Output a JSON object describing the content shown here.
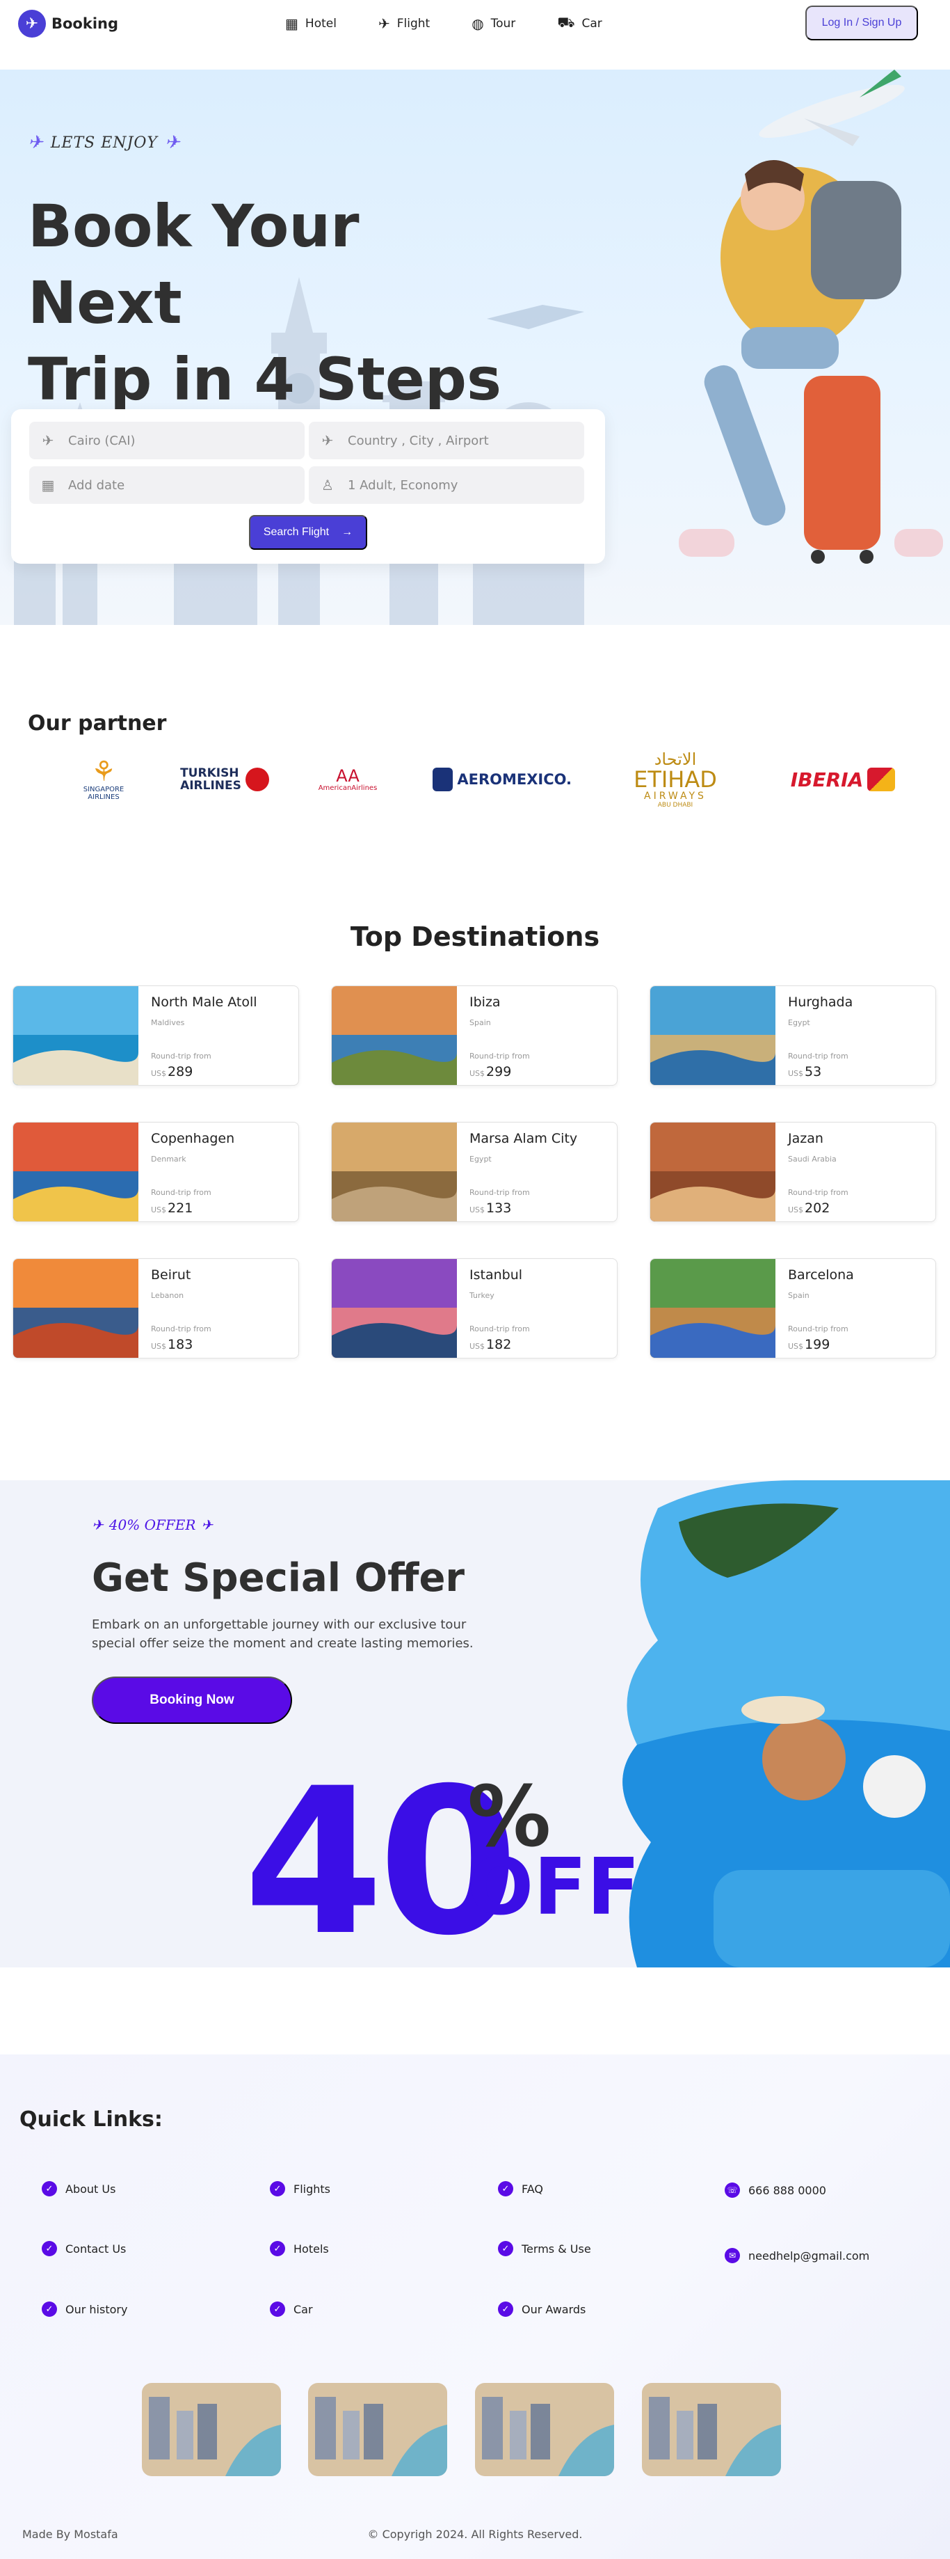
{
  "nav": {
    "brand": "Booking",
    "links": [
      {
        "label": "Hotel",
        "icon": "building-icon"
      },
      {
        "label": "Flight",
        "icon": "plane-icon"
      },
      {
        "label": "Tour",
        "icon": "globe-icon"
      },
      {
        "label": "Car",
        "icon": "car-icon"
      }
    ],
    "login_label": "Log In / Sign Up"
  },
  "hero": {
    "tag": "LETS ENJOY",
    "title_line1": "Book Your Next",
    "title_line2": "Trip in 4 Steps",
    "search": {
      "from": "Cairo (CAI)",
      "to": "Country , City , Airport",
      "date": "Add date",
      "travelers": "1 Adult, Economy",
      "button": "Search Flight"
    }
  },
  "partners": {
    "title": "Our partner",
    "logos": [
      {
        "name": "Singapore Airlines",
        "line1": "SINGAPORE",
        "line2": "AIRLINES"
      },
      {
        "name": "Turkish Airlines",
        "line1": "TURKISH",
        "line2": "AIRLINES"
      },
      {
        "name": "American Airlines",
        "line1": "AmericanAirlines"
      },
      {
        "name": "Aeromexico",
        "line1": "AEROMEXICO."
      },
      {
        "name": "Etihad Airways",
        "line1": "الاتحاد",
        "line2": "ETIHAD",
        "line3": "AIRWAYS",
        "line4": "ABU DHABI"
      },
      {
        "name": "Iberia",
        "line1": "IBERIA"
      }
    ]
  },
  "destinations": {
    "title": "Top Destinations",
    "from_label": "Round-trip from",
    "currency": "US$",
    "items": [
      {
        "name": "North Male Atoll",
        "country": "Maldives",
        "price": "289"
      },
      {
        "name": "Ibiza",
        "country": "Spain",
        "price": "299"
      },
      {
        "name": "Hurghada",
        "country": "Egypt",
        "price": "53"
      },
      {
        "name": "Copenhagen",
        "country": "Denmark",
        "price": "221"
      },
      {
        "name": "Marsa Alam City",
        "country": "Egypt",
        "price": "133"
      },
      {
        "name": "Jazan",
        "country": "Saudi Arabia",
        "price": "202"
      },
      {
        "name": "Beirut",
        "country": "Lebanon",
        "price": "183"
      },
      {
        "name": "Istanbul",
        "country": "Turkey",
        "price": "182"
      },
      {
        "name": "Barcelona",
        "country": "Spain",
        "price": "199"
      }
    ]
  },
  "offer": {
    "tag": "40% OFFER",
    "title": "Get Special Offer",
    "description": "Embark on an unforgettable journey with our exclusive tour special offer seize the moment and create lasting memories.",
    "button": "Booking Now",
    "big_number": "40",
    "percent": "%",
    "off": "OFF"
  },
  "footer": {
    "quick_title": "Quick Links:",
    "links": [
      "About Us",
      "Flights",
      "FAQ",
      "Contact Us",
      "Hotels",
      "Terms & Use",
      "Our history",
      "Car",
      "Our Awards"
    ],
    "phone": "666 888 0000",
    "email": "needhelp@gmail.com",
    "made_by": "Made By Mostafa",
    "copyright": "© Copyrigh 2024. All Rights Reserved."
  },
  "colors": {
    "primary": "#4a3fd6",
    "offer_purple": "#5a0be6",
    "offer_big": "#3b0ee6"
  }
}
